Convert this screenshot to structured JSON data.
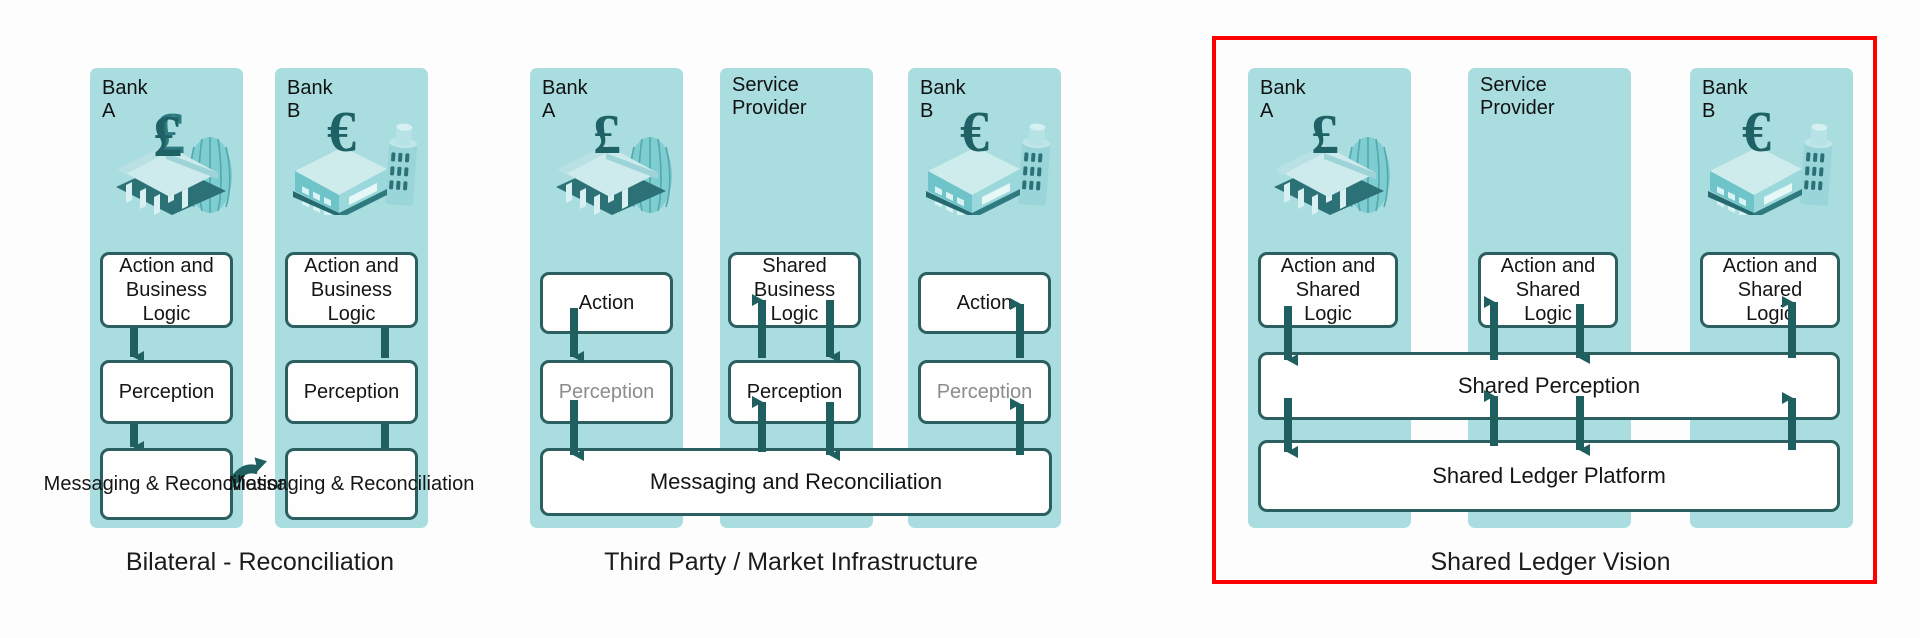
{
  "diagram": {
    "title_colors": {
      "panel_fill": "#a9dde0",
      "box_border": "#2b5f60",
      "arrow": "#1f5f60",
      "highlight": "#ff0000",
      "dim_text": "#8c8c8c"
    },
    "panels": [
      {
        "id": "bilateral",
        "caption": "Bilateral - Reconciliation",
        "highlighted": false,
        "columns": [
          {
            "label": "Bank A",
            "icon": "bank-classical-pound-icon",
            "currency": "£",
            "boxes": [
              {
                "label": "Action and\nBusiness\nLogic",
                "dim": false
              },
              {
                "label": "Perception",
                "dim": false
              },
              {
                "label": "Messaging &\nReconciliation",
                "dim": false
              }
            ]
          },
          {
            "label": "Bank B",
            "icon": "bank-modern-euro-icon",
            "currency": "€",
            "boxes": [
              {
                "label": "Action and\nBusiness\nLogic",
                "dim": false
              },
              {
                "label": "Perception",
                "dim": false
              },
              {
                "label": "Messaging &\nReconciliation",
                "dim": false
              }
            ]
          }
        ]
      },
      {
        "id": "third-party",
        "caption": "Third Party / Market Infrastructure",
        "highlighted": false,
        "columns": [
          {
            "label": "Bank A",
            "icon": "bank-classical-pound-icon",
            "currency": "£",
            "boxes": [
              {
                "label": "Action",
                "dim": false
              },
              {
                "label": "Perception",
                "dim": true
              }
            ]
          },
          {
            "label": "Service\nProvider",
            "icon": "none",
            "currency": "",
            "boxes": [
              {
                "label": "Shared\nBusiness\nLogic",
                "dim": false
              },
              {
                "label": "Perception",
                "dim": false
              }
            ]
          },
          {
            "label": "Bank B",
            "icon": "bank-modern-euro-icon",
            "currency": "€",
            "boxes": [
              {
                "label": "Action",
                "dim": false
              },
              {
                "label": "Perception",
                "dim": true
              }
            ]
          }
        ],
        "shared_bars": [
          {
            "label": "Messaging and Reconciliation"
          }
        ]
      },
      {
        "id": "shared-ledger",
        "caption": "Shared Ledger Vision",
        "highlighted": true,
        "columns": [
          {
            "label": "Bank A",
            "icon": "bank-classical-pound-icon",
            "currency": "£",
            "boxes": [
              {
                "label": "Action and\nShared\nLogic",
                "dim": false
              }
            ]
          },
          {
            "label": "Service\nProvider",
            "icon": "none",
            "currency": "",
            "boxes": [
              {
                "label": "Action and\nShared\nLogic",
                "dim": false
              }
            ]
          },
          {
            "label": "Bank B",
            "icon": "bank-modern-euro-icon",
            "currency": "€",
            "boxes": [
              {
                "label": "Action and\nShared\nLogic",
                "dim": false
              }
            ]
          }
        ],
        "shared_bars": [
          {
            "label": "Shared Perception"
          },
          {
            "label": "Shared Ledger Platform"
          }
        ]
      }
    ]
  }
}
